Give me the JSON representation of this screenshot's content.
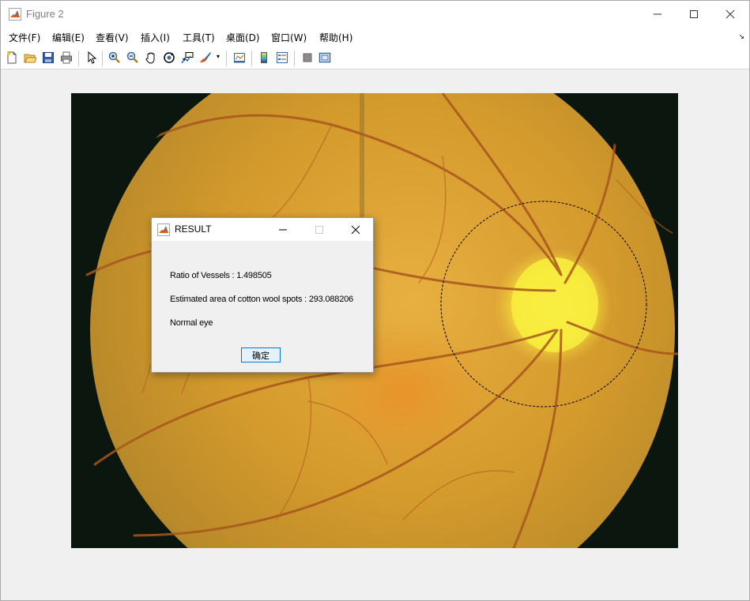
{
  "window": {
    "title": "Figure 2",
    "controls": {
      "minimize": "minimize-icon",
      "maximize": "maximize-icon",
      "close": "close-icon"
    }
  },
  "menubar": {
    "items": [
      "文件(F)",
      "编辑(E)",
      "查看(V)",
      "插入(I)",
      "工具(T)",
      "桌面(D)",
      "窗口(W)",
      "帮助(H)"
    ]
  },
  "toolbar": {
    "icons": [
      "new-figure-icon",
      "open-file-icon",
      "save-icon",
      "print-icon",
      "pointer-icon",
      "zoom-in-icon",
      "zoom-out-icon",
      "pan-icon",
      "rotate-3d-icon",
      "data-cursor-icon",
      "brush-icon",
      "link-plot-icon",
      "colorbar-icon",
      "legend-icon",
      "hide-plot-tools-icon",
      "show-plot-tools-icon"
    ]
  },
  "figure": {
    "image": "retinal-fundus-image",
    "annotation": "optic-disc-circle",
    "colors": {
      "background": "#0b160e",
      "retina": "#d9a233",
      "optic_disc": "#f6ee3c",
      "vessel": "#a8571c",
      "circle": "#000000"
    }
  },
  "dialog": {
    "title": "RESULT",
    "lines": [
      "Ratio of Vessels : 1.498505",
      "Estimated area of cotton wool spots : 293.088206",
      "Normal eye"
    ],
    "ok_label": "确定"
  }
}
